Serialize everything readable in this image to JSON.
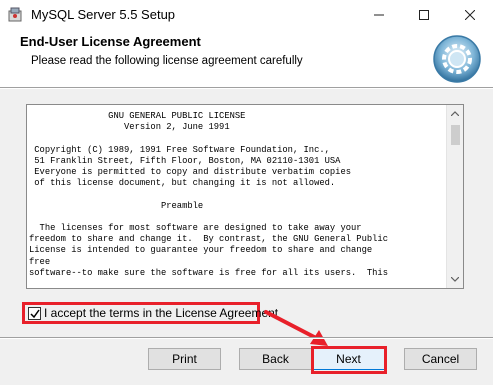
{
  "window": {
    "title": "MySQL Server 5.5 Setup",
    "minimize_glyph": "—",
    "maximize_glyph": "☐",
    "close_glyph": "✕"
  },
  "banner": {
    "title": "End-User License Agreement",
    "subtitle": "Please read the following license agreement carefully"
  },
  "license": {
    "text": "               GNU GENERAL PUBLIC LICENSE\n                  Version 2, June 1991\n\n Copyright (C) 1989, 1991 Free Software Foundation, Inc.,\n 51 Franklin Street, Fifth Floor, Boston, MA 02110-1301 USA\n Everyone is permitted to copy and distribute verbatim copies\n of this license document, but changing it is not allowed.\n\n                         Preamble\n\n  The licenses for most software are designed to take away your\nfreedom to share and change it.  By contrast, the GNU General Public\nLicense is intended to guarantee your freedom to share and change\nfree\nsoftware--to make sure the software is free for all its users.  This"
  },
  "accept": {
    "label": "I accept the terms in the License Agreement",
    "checked": true
  },
  "buttons": {
    "print": "Print",
    "back": "Back",
    "next": "Next",
    "cancel": "Cancel"
  },
  "colors": {
    "highlight": "#e8202a",
    "accent": "#0078d7"
  },
  "icons": {
    "app": "installer-icon",
    "logo": "gear-disc-icon",
    "checkbox": "checkmark-icon",
    "arrow": "red-arrow-icon"
  }
}
